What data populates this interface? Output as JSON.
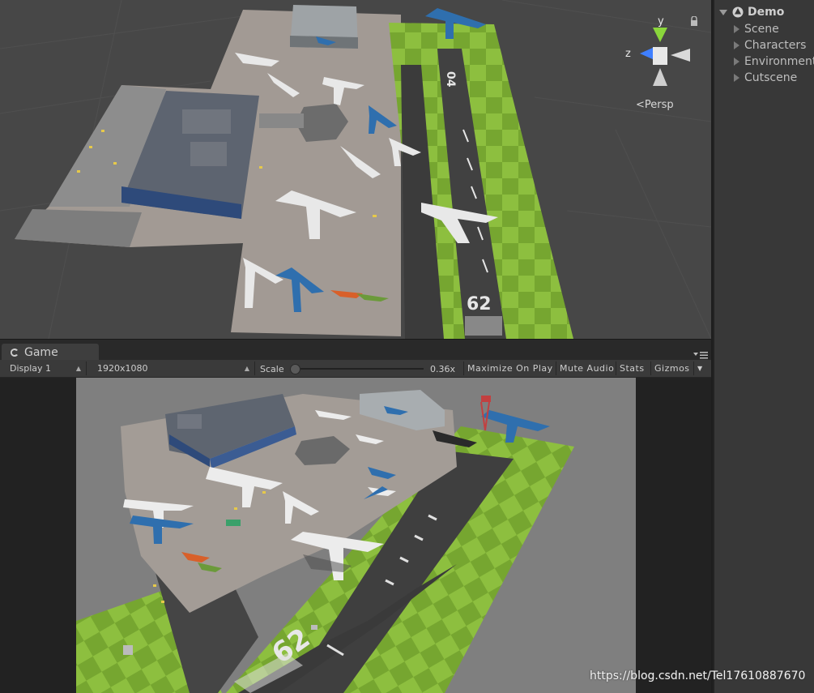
{
  "scene_view": {
    "projection_label": "Persp",
    "axis_labels": {
      "y": "y",
      "z": "z"
    }
  },
  "hierarchy": {
    "root": "Demo",
    "items": [
      {
        "label": "Scene"
      },
      {
        "label": "Characters"
      },
      {
        "label": "Environment"
      },
      {
        "label": "Cutscene"
      }
    ]
  },
  "game": {
    "tab_label": "Game",
    "display": "Display 1",
    "resolution": "1920x1080",
    "scale_label": "Scale",
    "scale_value": "0.36x",
    "buttons": {
      "maximize": "Maximize On Play",
      "mute": "Mute Audio",
      "stats": "Stats",
      "gizmos": "Gizmos"
    },
    "runway_number": "62"
  },
  "scene_runway_numbers": {
    "top": "04",
    "bottom": "62"
  },
  "watermark": "https://blog.csdn.net/Tel17610887670",
  "colors": {
    "grass_light": "#8dbf3f",
    "grass_dark": "#75a52f",
    "asphalt": "#3f3f3f",
    "apron": "#a59e98",
    "plane_blue": "#2f6fae",
    "editor_bg": "#383838"
  },
  "icons": [
    "unity-icon",
    "lock-icon",
    "panel-menu-icon",
    "game-icon",
    "axis-gizmo"
  ]
}
